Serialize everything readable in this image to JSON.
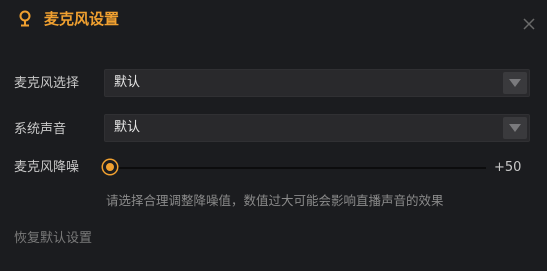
{
  "header": {
    "title": "麦克风设置",
    "icon": "microphone-icon",
    "close_icon": "close-icon"
  },
  "fields": {
    "mic_select": {
      "label": "麦克风选择",
      "value": "默认",
      "icon": "chevron-down-icon"
    },
    "system_sound": {
      "label": "系统声音",
      "value": "默认",
      "icon": "chevron-down-icon"
    },
    "noise_reduction": {
      "label": "麦克风降噪",
      "value_text": "+50",
      "level": 0,
      "hint": "请选择合理调整降噪值，数值过大可能会影响直播声音的效果"
    }
  },
  "footer": {
    "reset_label": "恢复默认设置"
  },
  "colors": {
    "accent": "#f0a030",
    "background": "#1b1c1f"
  }
}
